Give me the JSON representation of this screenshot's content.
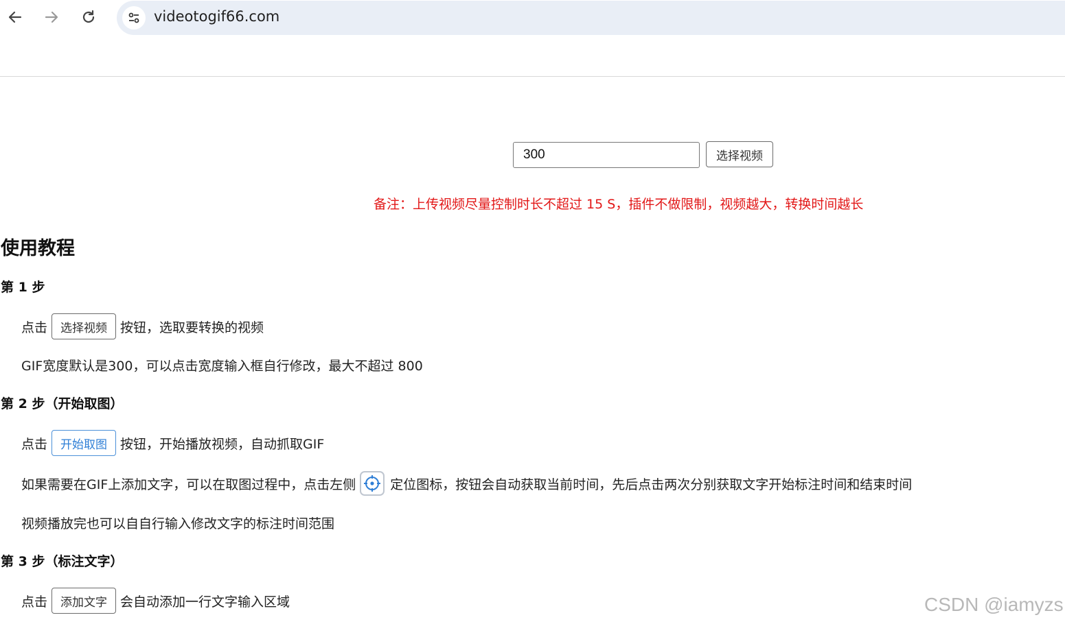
{
  "browser": {
    "url": "videotogif66.com"
  },
  "controls": {
    "width_value": "300",
    "select_video_label": "选择视频",
    "note": "备注：上传视频尽量控制时长不超过 15 S，插件不做限制，视频越大，转换时间越长"
  },
  "tutorial": {
    "title": "使用教程",
    "step1": {
      "heading": "第 1 步",
      "line1_prefix": "点击",
      "line1_button": "选择视频",
      "line1_suffix": "按钮，选取要转换的视频",
      "line2": "GIF宽度默认是300，可以点击宽度输入框自行修改，最大不超过 800"
    },
    "step2": {
      "heading": "第 2 步（开始取图）",
      "line1_prefix": "点击",
      "line1_button": "开始取图",
      "line1_suffix": "按钮，开始播放视频，自动抓取GIF",
      "line2_prefix": "如果需要在GIF上添加文字，可以在取图过程中，点击左侧",
      "line2_suffix": "定位图标，按钮会自动获取当前时间，先后点击两次分别获取文字开始标注时间和结束时间",
      "line3": "视频播放完也可以自自行输入修改文字的标注时间范围"
    },
    "step3": {
      "heading": "第 3 步（标注文字）",
      "line1_prefix": "点击",
      "line1_button": "添加文字",
      "line1_suffix": "会自动添加一行文字输入区域"
    }
  },
  "watermark": "CSDN @iamyzs",
  "colors": {
    "note_red": "#e21717",
    "accent_blue": "#2f7fd6",
    "omnibox_bg": "#e9eef6"
  }
}
